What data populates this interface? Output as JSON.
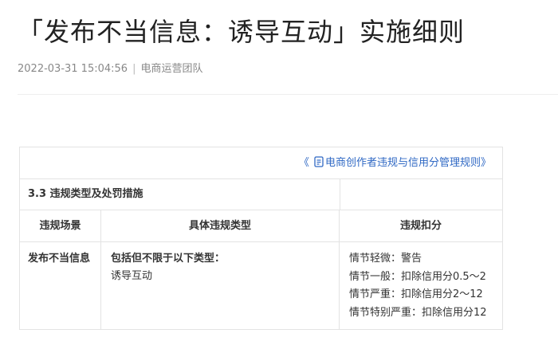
{
  "article": {
    "title": "「发布不当信息：诱导互动」实施细则",
    "datetime": "2022-03-31 15:04:56",
    "separator": "|",
    "author": "电商运营团队"
  },
  "rules_table": {
    "reference_link": {
      "open_bracket": "《",
      "icon": "document-icon",
      "label": "电商创作者违规与信用分管理规则",
      "close_bracket": "》",
      "color": "#2f68c4"
    },
    "section_title": "3.3 违规类型及处罚措施",
    "columns": [
      "违规场景",
      "具体违规类型",
      "违规扣分"
    ],
    "rows": [
      {
        "scene": "发布不当信息",
        "types_lead": "包括但不限于以下类型：",
        "types": [
          "诱导互动"
        ],
        "penalties": [
          "情节轻微：警告",
          "情节一般：扣除信用分0.5～2",
          "情节严重：扣除信用分2～12",
          "情节特别严重：扣除信用分12"
        ]
      }
    ]
  }
}
